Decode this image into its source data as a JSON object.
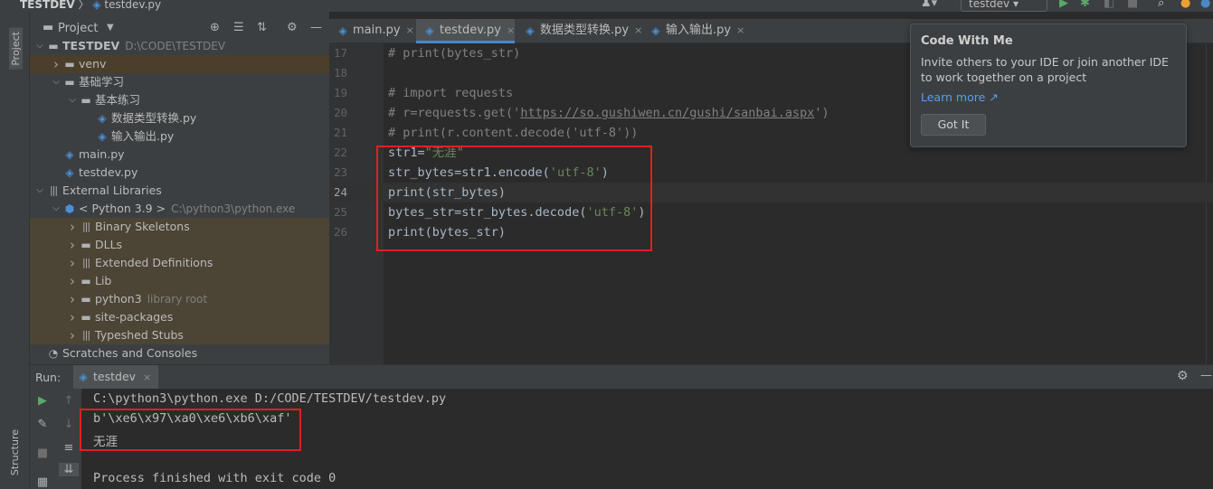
{
  "titlebar": {
    "project": "TESTDEV",
    "separator": "〉",
    "file": "testdev.py",
    "run_config": "testdev"
  },
  "left_strip": {
    "project_tab": "Project",
    "structure_tab": "Structure"
  },
  "project_panel": {
    "title": "Project",
    "tree": [
      {
        "label": "TESTDEV",
        "path": "D:\\CODE\\TESTDEV",
        "type": "root",
        "level": 0,
        "arrow": "down"
      },
      {
        "label": "venv",
        "type": "folder",
        "level": 1,
        "arrow": "right",
        "selected": true
      },
      {
        "label": "基础学习",
        "type": "folder",
        "level": 1,
        "arrow": "down"
      },
      {
        "label": "基本练习",
        "type": "folder",
        "level": 2,
        "arrow": "down"
      },
      {
        "label": "数据类型转换.py",
        "type": "py",
        "level": 3,
        "arrow": ""
      },
      {
        "label": "输入输出.py",
        "type": "py",
        "level": 3,
        "arrow": ""
      },
      {
        "label": "main.py",
        "type": "py",
        "level": 1,
        "arrow": ""
      },
      {
        "label": "testdev.py",
        "type": "py",
        "level": 1,
        "arrow": ""
      },
      {
        "label": "External Libraries",
        "type": "lib",
        "level": 0,
        "arrow": "down"
      },
      {
        "label": "< Python 3.9 >",
        "path": "C:\\python3\\python.exe",
        "type": "python",
        "level": 1,
        "arrow": "down"
      },
      {
        "label": "Binary Skeletons",
        "type": "lib",
        "level": 2,
        "arrow": "right",
        "lib": true
      },
      {
        "label": "DLLs",
        "type": "folder",
        "level": 2,
        "arrow": "right",
        "lib": true
      },
      {
        "label": "Extended Definitions",
        "type": "lib",
        "level": 2,
        "arrow": "right",
        "lib": true
      },
      {
        "label": "Lib",
        "type": "folder",
        "level": 2,
        "arrow": "right",
        "lib": true
      },
      {
        "label": "python3",
        "path": "library root",
        "type": "folder",
        "level": 2,
        "arrow": "right",
        "lib": true
      },
      {
        "label": "site-packages",
        "type": "folder",
        "level": 2,
        "arrow": "right",
        "lib": true
      },
      {
        "label": "Typeshed Stubs",
        "type": "lib",
        "level": 2,
        "arrow": "right",
        "lib": true
      },
      {
        "label": "Scratches and Consoles",
        "type": "scratch",
        "level": 0,
        "arrow": ""
      }
    ]
  },
  "editor": {
    "tabs": [
      {
        "label": "main.py",
        "active": false
      },
      {
        "label": "testdev.py",
        "active": true
      },
      {
        "label": "数据类型转换.py",
        "active": false
      },
      {
        "label": "输入输出.py",
        "active": false
      }
    ],
    "close_glyph": "×",
    "lines": [
      {
        "num": "17",
        "segments": [
          {
            "t": "# print(bytes_str)",
            "c": "cmt"
          }
        ]
      },
      {
        "num": "18",
        "segments": []
      },
      {
        "num": "19",
        "segments": [
          {
            "t": "# import requests",
            "c": "cmt"
          }
        ]
      },
      {
        "num": "20",
        "segments": [
          {
            "t": "# r=requests.get('",
            "c": "cmt"
          },
          {
            "t": "https://so.gushiwen.cn/gushi/sanbai.aspx",
            "c": "url"
          },
          {
            "t": "')",
            "c": "cmt"
          }
        ]
      },
      {
        "num": "21",
        "segments": [
          {
            "t": "# print(r.content.decode('utf-8'))",
            "c": "cmt"
          }
        ]
      },
      {
        "num": "22",
        "segments": [
          {
            "t": "str1=",
            "c": "kw"
          },
          {
            "t": "\"无涯\"",
            "c": "str"
          }
        ]
      },
      {
        "num": "23",
        "segments": [
          {
            "t": "str_bytes=str1.encode(",
            "c": "kw"
          },
          {
            "t": "'utf-8'",
            "c": "str"
          },
          {
            "t": ")",
            "c": "kw"
          }
        ]
      },
      {
        "num": "24",
        "current": true,
        "segments": [
          {
            "t": "print(str_bytes)",
            "c": "kw"
          }
        ]
      },
      {
        "num": "25",
        "segments": [
          {
            "t": "bytes_str=str_bytes.decode(",
            "c": "kw"
          },
          {
            "t": "'utf-8'",
            "c": "str"
          },
          {
            "t": ")",
            "c": "kw"
          }
        ]
      },
      {
        "num": "26",
        "segments": [
          {
            "t": "print(bytes_str)",
            "c": "kw"
          }
        ]
      }
    ]
  },
  "popup": {
    "title": "Code With Me",
    "body": "Invite others to your IDE or join another IDE to work together on a project",
    "link": "Learn more ↗",
    "button": "Got It"
  },
  "run": {
    "label": "Run:",
    "tab": "testdev",
    "close_glyph": "×",
    "output": [
      "C:\\python3\\python.exe D:/CODE/TESTDEV/testdev.py",
      "b'\\xe6\\x97\\xa0\\xe6\\xb6\\xaf'",
      "无涯",
      "",
      "Process finished with exit code 0"
    ]
  },
  "colors": {
    "accent": "#4a88c7",
    "highlight_box": "#e02020",
    "link": "#589df6"
  }
}
